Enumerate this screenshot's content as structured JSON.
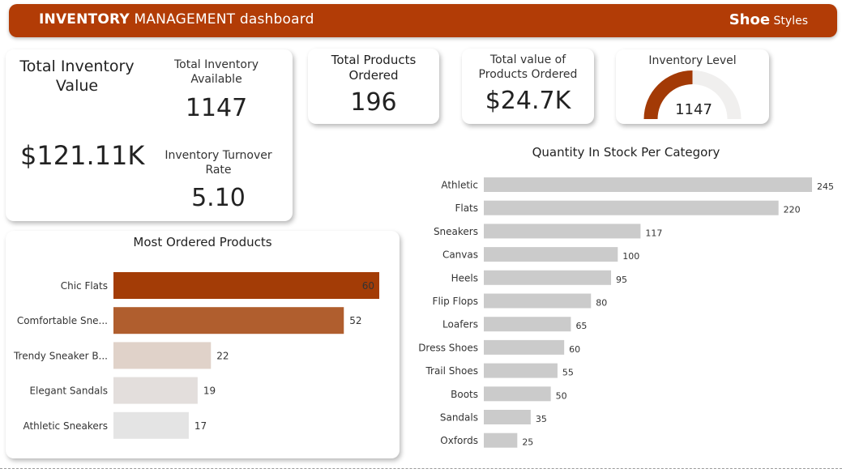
{
  "header": {
    "title_bold": "INVENTORY",
    "title_rest": " MANAGEMENT dashboard",
    "brand_bold": "Shoe",
    "brand_rest": " Styles"
  },
  "kpis": {
    "total_inventory_value": {
      "label": "Total Inventory Value",
      "value": "$121.11K"
    },
    "total_inventory_available": {
      "label": "Total Inventory Available",
      "value": "1147"
    },
    "inventory_turnover_rate": {
      "label": "Inventory Turnover Rate",
      "value": "5.10"
    },
    "total_products_ordered": {
      "label": "Total Products Ordered",
      "value": "196"
    },
    "total_value_ordered": {
      "label": "Total value of Products Ordered",
      "value": "$24.7K"
    },
    "inventory_level": {
      "label": "Inventory Level",
      "value": "1147",
      "fill_fraction": 0.5,
      "color": "#a33a06",
      "track_color": "#f0efee"
    }
  },
  "chart_data": [
    {
      "type": "bar",
      "orientation": "horizontal",
      "title": "Most Ordered Products",
      "categories": [
        "Chic Flats",
        "Comfortable Sne...",
        "Trendy Sneaker B...",
        "Elegant Sandals",
        "Athletic Sneakers"
      ],
      "values": [
        60,
        52,
        22,
        19,
        17
      ],
      "colors": [
        "#a33c06",
        "#b05e2e",
        "#e0d2c9",
        "#e3dedc",
        "#e4e4e4"
      ],
      "xlim": [
        0,
        60
      ],
      "grid": false
    },
    {
      "type": "bar",
      "orientation": "horizontal",
      "title": "Quantity In Stock Per Category",
      "categories": [
        "Athletic",
        "Flats",
        "Sneakers",
        "Canvas",
        "Heels",
        "Flip Flops",
        "Loafers",
        "Dress Shoes",
        "Trail Shoes",
        "Boots",
        "Sandals",
        "Oxfords"
      ],
      "values": [
        245,
        220,
        117,
        100,
        95,
        80,
        65,
        60,
        55,
        50,
        35,
        25
      ],
      "color": "#cbcbcb",
      "xlim": [
        0,
        245
      ],
      "grid": false
    }
  ]
}
